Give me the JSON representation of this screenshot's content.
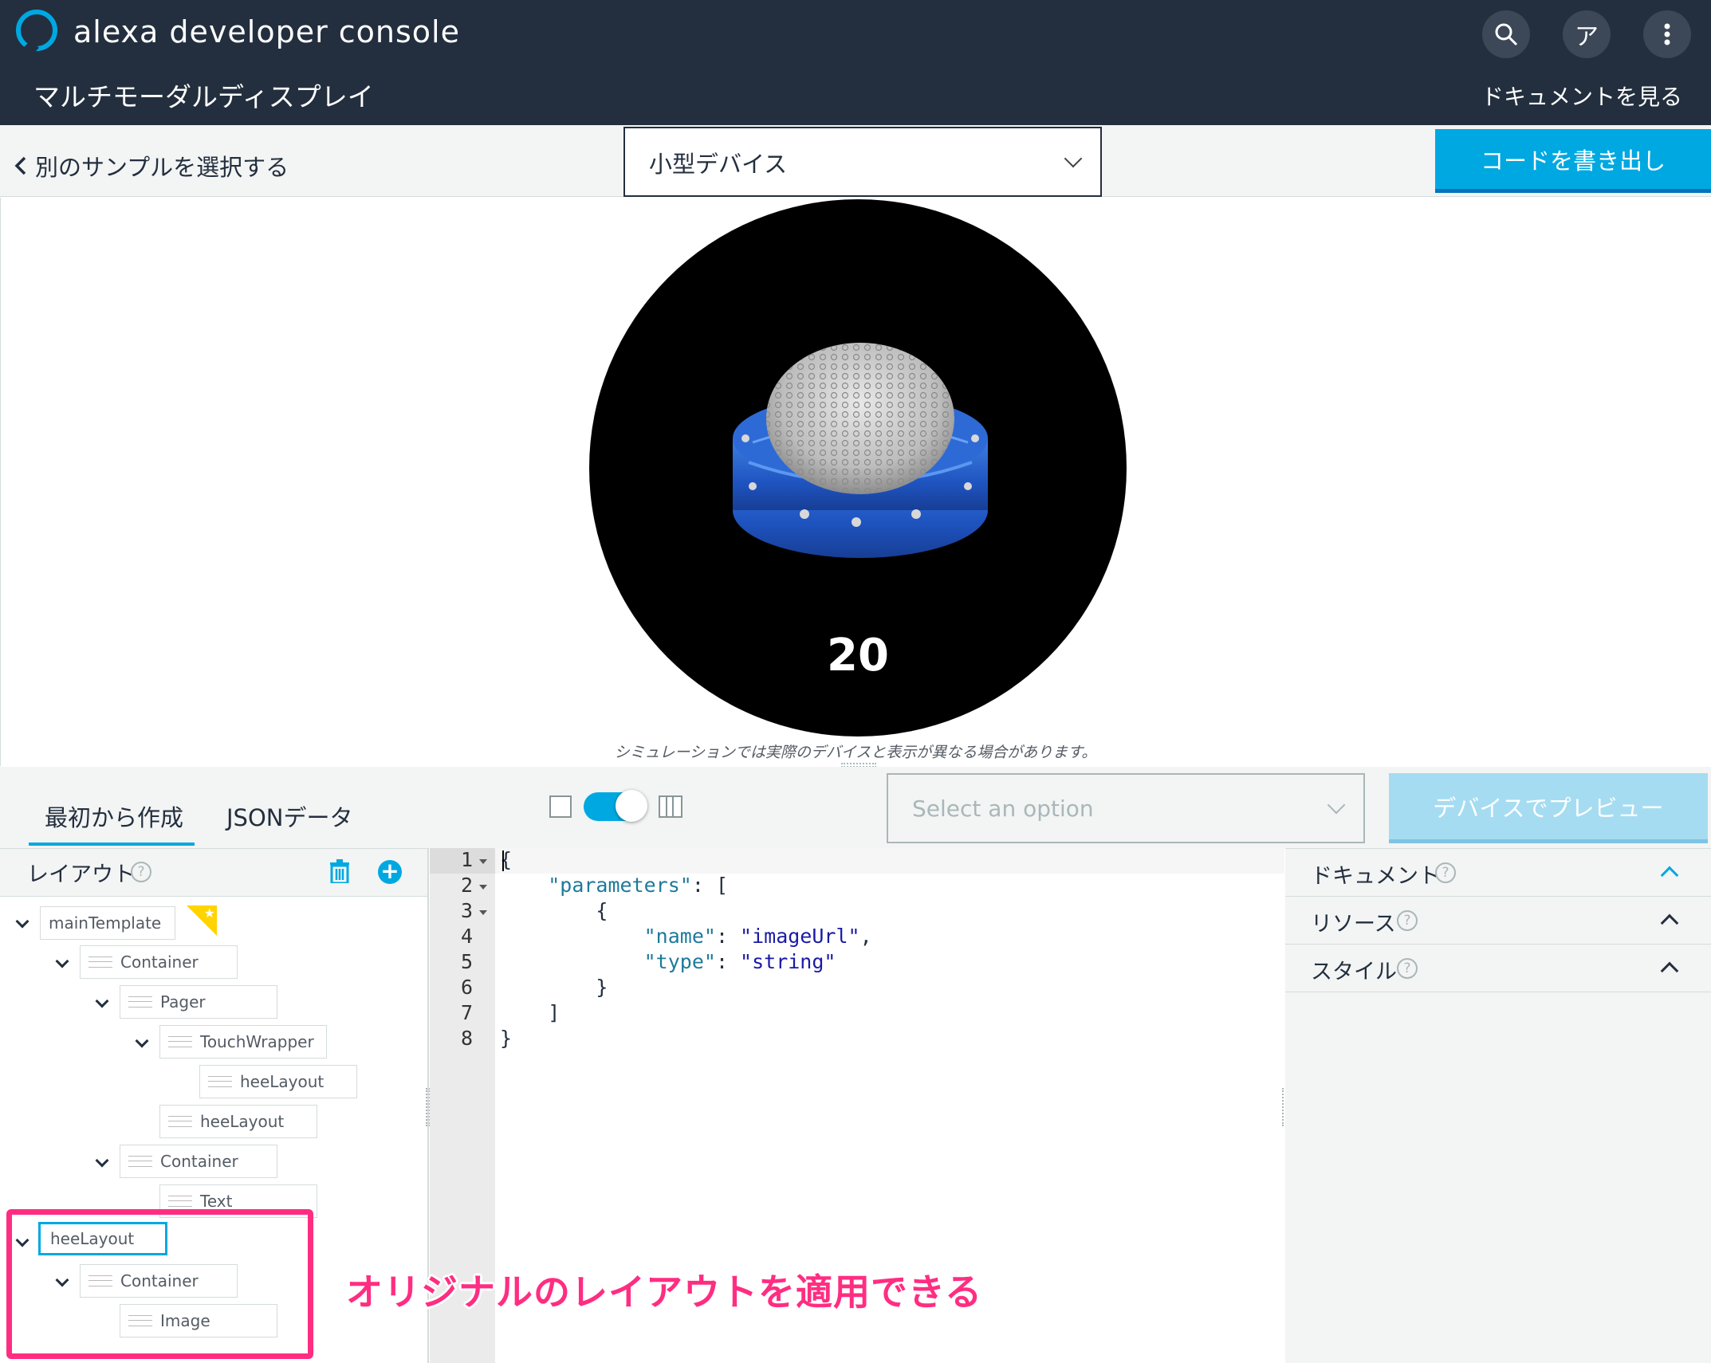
{
  "header": {
    "app_title": "alexa developer console",
    "page_title": "マルチモーダルディスプレイ",
    "docs_link": "ドキュメントを見る",
    "profile_initial": "ア"
  },
  "toolbar": {
    "back_label": "別のサンプルを選択する",
    "device_select_value": "小型デバイス",
    "export_label": "コードを書き出し"
  },
  "preview": {
    "device_number": "20",
    "simulation_note": "シミュレーションでは実際のデバイスと表示が異なる場合があります。"
  },
  "editor_bar": {
    "tabs": [
      "最初から作成",
      "JSONデータ"
    ],
    "option_placeholder": "Select an option",
    "device_preview_label": "デバイスでプレビュー"
  },
  "layout_panel": {
    "title": "レイアウト",
    "nodes": [
      "mainTemplate",
      "Container",
      "Pager",
      "TouchWrapper",
      "heeLayout",
      "heeLayout",
      "Container",
      "Text",
      "heeLayout",
      "Container",
      "Image"
    ]
  },
  "code": {
    "line_numbers": [
      "1",
      "2",
      "3",
      "4",
      "5",
      "6",
      "7",
      "8"
    ],
    "lines": [
      "{",
      "    \"parameters\": [",
      "        {",
      "            \"name\": \"imageUrl\",",
      "            \"type\": \"string\"",
      "        }",
      "    ]",
      "}"
    ],
    "key_parameters": "\"parameters\"",
    "key_name": "\"name\"",
    "val_name": "\"imageUrl\"",
    "key_type": "\"type\"",
    "val_type": "\"string\""
  },
  "right_panel": {
    "sections": [
      "ドキュメント",
      "リソース",
      "スタイル"
    ]
  },
  "annotation": "オリジナルのレイアウトを適用できる",
  "colors": {
    "header_bg": "#232f3e",
    "accent": "#00a8e1",
    "annotation": "#ff2d82"
  }
}
